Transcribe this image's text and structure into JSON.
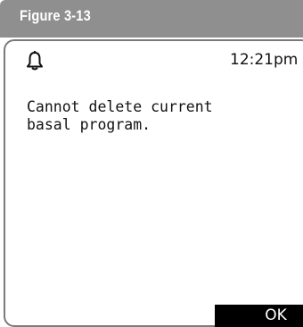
{
  "figure": {
    "label": "Figure 3-13"
  },
  "screen": {
    "alert_icon": "bell-icon",
    "time": "12:21pm",
    "message": "Cannot delete current\nbasal program.",
    "ok_label": "OK"
  }
}
